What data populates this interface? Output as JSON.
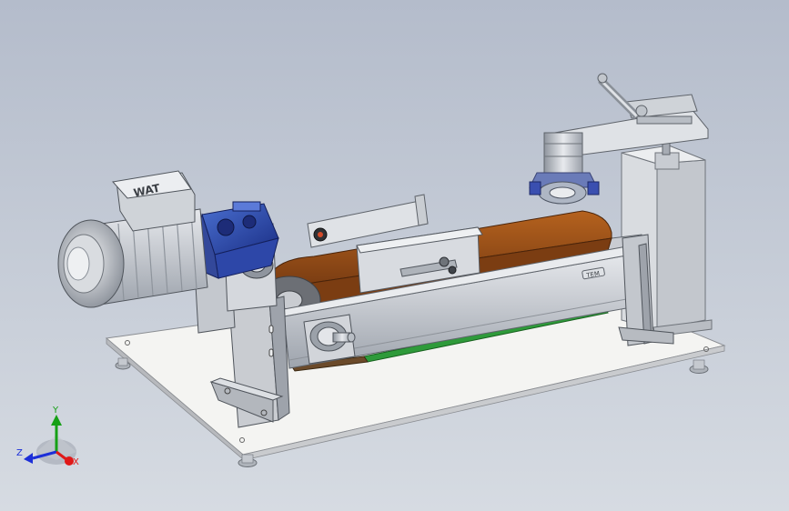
{
  "viewport": {
    "background_top": "#b4bccb",
    "background_bottom": "#d6dbe2"
  },
  "model": {
    "motor_nameplate_text": "WAT",
    "bracket_label_text": "TEM"
  },
  "triad": {
    "x_label": "X",
    "y_label": "Y",
    "z_label": "Z",
    "x_color": "#e01818",
    "y_color": "#16a016",
    "z_color": "#1c2fd8"
  }
}
